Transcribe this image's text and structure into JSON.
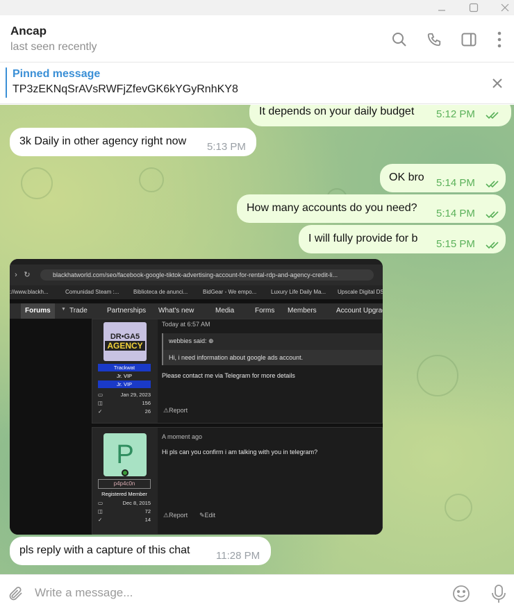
{
  "window": {
    "minimize_icon": "minimize-icon",
    "maximize_icon": "maximize-icon",
    "close_icon": "close-icon"
  },
  "header": {
    "name": "Ancap",
    "status": "last seen recently",
    "icons": [
      "search-icon",
      "phone-icon",
      "sidebar-toggle-icon",
      "more-vertical-icon"
    ]
  },
  "pinned": {
    "title": "Pinned message",
    "text": "TP3zEKNqSrAVsRWFjZfevGK6kYGyRnhKY8"
  },
  "messages": [
    {
      "direction": "out",
      "text": "It depends on your daily budget",
      "time": "5:12 PM",
      "read": true
    },
    {
      "direction": "in",
      "text": "3k Daily in other agency right now",
      "time": "5:13 PM"
    },
    {
      "direction": "out",
      "text": "OK bro",
      "time": "5:14 PM",
      "read": true
    },
    {
      "direction": "out",
      "text": "How many accounts do you need?",
      "time": "5:14 PM",
      "read": true
    },
    {
      "direction": "out",
      "text": "I will fully provide for b",
      "time": "5:15 PM",
      "read": true
    },
    {
      "direction": "in",
      "text": "pls reply  with a capture of this chat",
      "time": "11:28 PM"
    }
  ],
  "screenshot": {
    "url": "blackhatworld.com/seo/facebook-google-tiktok-advertising-account-for-rental-rdp-and-agency-credit-li...",
    "bookmarks": [
      "://www.blackh...",
      "Comunidad Steam :...",
      "Biblioteca de anunci...",
      "BidGear - We empo...",
      "Luxury Life Daily Ma...",
      "Upscale Digital DSP"
    ],
    "nav": [
      "Forums",
      "Trade",
      "Partnerships",
      "What's new",
      "Media",
      "Forms",
      "Members",
      "Account Upgrad"
    ],
    "post1": {
      "avatar_line1": "DR•GA5",
      "avatar_line2": "AGENCY",
      "username": "Trackwat",
      "rank1": "Jr. VIP",
      "rank2": "Jr. VIP",
      "joined": "Jan 29, 2023",
      "messages": "156",
      "reactions": "26",
      "time": "Today at 6:57 AM",
      "quote_author": "webbies said: ⊕",
      "quote_text": "Hi, i need information about google ads account.",
      "body": "Please contact me via Telegram for more details",
      "report": "⚠Report"
    },
    "post2": {
      "avatar_letter": "P",
      "username": "p4p4c0n",
      "rank": "Registered Member",
      "joined": "Dec 8, 2015",
      "messages": "72",
      "reactions": "14",
      "time": "A moment ago",
      "body": "Hi pls can you confirm i am talking with you in telegram?",
      "report": "⚠Report",
      "edit": "✎Edit"
    }
  },
  "composer": {
    "placeholder": "Write a message...",
    "icons": [
      "paperclip-icon",
      "emoji-icon",
      "microphone-icon"
    ]
  },
  "colors": {
    "accent": "#3a8fd6",
    "outgoing_bubble": "#effdde",
    "read_tick": "#5bb15a",
    "chat_bg": "#a8c98e"
  }
}
